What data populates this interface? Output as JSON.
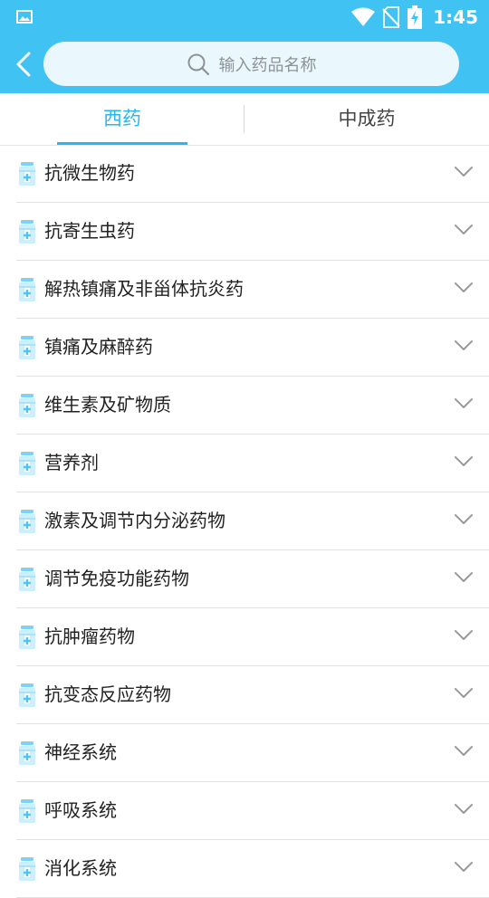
{
  "status_bar": {
    "time": "1:45",
    "icons": [
      "gallery-icon",
      "wifi-icon",
      "no-sim-icon",
      "battery-charging-icon"
    ]
  },
  "header": {
    "back_icon": "chevron-left-icon",
    "search": {
      "placeholder": "输入药品名称",
      "icon": "search-icon"
    }
  },
  "tabs": [
    {
      "label": "西药",
      "selected": true
    },
    {
      "label": "中成药",
      "selected": false
    }
  ],
  "categories": [
    "抗微生物药",
    "抗寄生虫药",
    "解热镇痛及非甾体抗炎药",
    "镇痛及麻醉药",
    "维生素及矿物质",
    "营养剂",
    "激素及调节内分泌药物",
    "调节免疫功能药物",
    "抗肿瘤药物",
    "抗变态反应药物",
    "神经系统",
    "呼吸系统",
    "消化系统"
  ],
  "colors": {
    "header_bg": "#40c3f2",
    "accent": "#29b6ef",
    "search_bg": "#eaf7fd"
  }
}
